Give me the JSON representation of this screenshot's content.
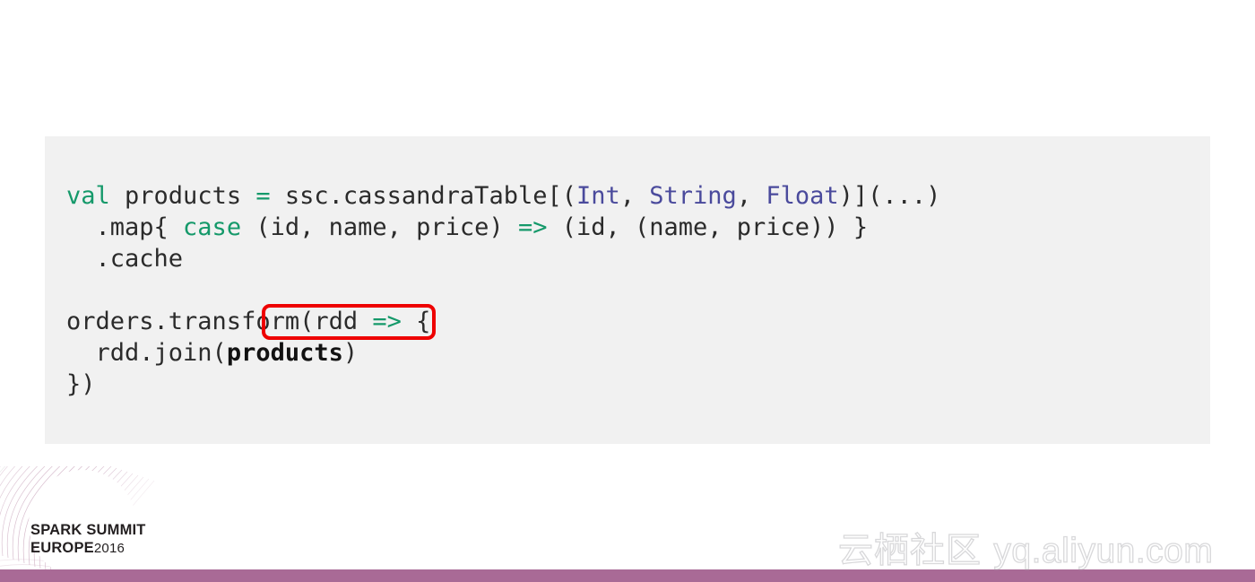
{
  "slide": {
    "background_color": "#ffffff"
  },
  "code_block": {
    "background_color": "#f1f1f1",
    "language": "scala",
    "keyword_color": "#15996a",
    "type_color": "#4a4a9c",
    "text_color": "#2b2b2b",
    "lines": [
      {
        "index": 1,
        "text": "val products = ssc.cassandraTable[(Int, String, Float)](...)",
        "tokens": [
          {
            "t": "val",
            "k": "keyword"
          },
          {
            "t": " products ",
            "k": "plain"
          },
          {
            "t": "=",
            "k": "operator"
          },
          {
            "t": " ssc.cassandraTable[(",
            "k": "plain"
          },
          {
            "t": "Int",
            "k": "type"
          },
          {
            "t": ", ",
            "k": "plain"
          },
          {
            "t": "String",
            "k": "type"
          },
          {
            "t": ", ",
            "k": "plain"
          },
          {
            "t": "Float",
            "k": "type"
          },
          {
            "t": ")](...)",
            "k": "plain"
          }
        ]
      },
      {
        "index": 2,
        "text": "  .map{ case (id, name, price) => (id, (name, price)) }",
        "tokens": [
          {
            "t": "  .map{ ",
            "k": "plain"
          },
          {
            "t": "case",
            "k": "keyword"
          },
          {
            "t": " (id, name, price) ",
            "k": "plain"
          },
          {
            "t": "=>",
            "k": "operator"
          },
          {
            "t": " (id, (name, price)) }",
            "k": "plain"
          }
        ]
      },
      {
        "index": 3,
        "text": "  .cache",
        "tokens": [
          {
            "t": "  .cache",
            "k": "plain"
          }
        ]
      },
      {
        "index": 4,
        "text": "",
        "tokens": [
          {
            "t": "",
            "k": "plain"
          }
        ]
      },
      {
        "index": 5,
        "text": "orders.transform(rdd => {",
        "tokens": [
          {
            "t": "orders.transform(rdd ",
            "k": "plain"
          },
          {
            "t": "=>",
            "k": "operator"
          },
          {
            "t": " {",
            "k": "plain"
          }
        ]
      },
      {
        "index": 6,
        "text": "  rdd.join(products)",
        "tokens": [
          {
            "t": "  rdd.join(",
            "k": "plain"
          },
          {
            "t": "products",
            "k": "highlight"
          },
          {
            "t": ")",
            "k": "plain"
          }
        ]
      },
      {
        "index": 7,
        "text": "})",
        "tokens": [
          {
            "t": "})",
            "k": "plain"
          }
        ]
      }
    ]
  },
  "annotation": {
    "type": "rounded-rectangle-outline",
    "target_text": "products",
    "color": "#ee0000",
    "stroke_width_px": 4
  },
  "footer": {
    "bar_color": "#a96a96",
    "logo": {
      "line1": "SPARK SUMMIT",
      "line2": "EUROPE",
      "year": "2016",
      "artwork_color": "#b98aa8"
    }
  },
  "watermark": {
    "chinese": "云栖社区",
    "url": "yq.aliyun.com",
    "color": "#a8a8ac"
  }
}
